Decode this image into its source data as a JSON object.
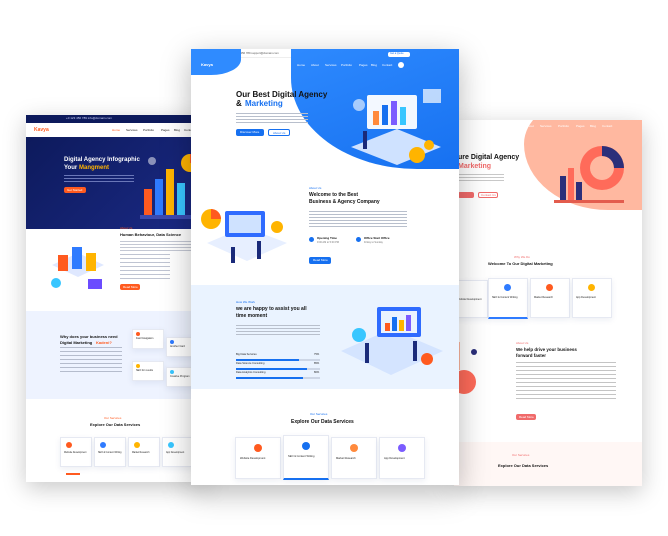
{
  "colors": {
    "blue": "#1670f0",
    "orange": "#ff5a1f",
    "navy": "#0d1a5c",
    "peach": "#ffb8a0",
    "pink": "#f06a6a"
  },
  "left": {
    "contact": "+0 123 456 789  info@domain.com",
    "logo": "Kavya",
    "nav": [
      "Home",
      "Services",
      "Portfolio",
      "Pages",
      "Blog",
      "Contact"
    ],
    "hero_title_1": "Digital Agency Infographic",
    "hero_title_2": "Your",
    "hero_title_hl": "Mangment",
    "hero_btn": "Get Started",
    "about_kicker": "About Us",
    "about_title": "Human Behaviour, Data Science",
    "about_btn": "Read More",
    "why_title_1": "Why does your business need",
    "why_title_2": "Digital Marketing",
    "why_title_hl": "Kadeni?",
    "why_cards": [
      "Fast Navigation",
      "Another Card",
      "SEO for results",
      "Creative Program"
    ],
    "services_kicker": "Our Services",
    "services_title": "Explore Our Data Services",
    "services": [
      "Website Development",
      "SEO & Content Writing",
      "Market Research",
      "App Development"
    ]
  },
  "center": {
    "contact": "+0 123 456 789  support@domain.com",
    "logo": "Kavya",
    "nav": [
      "Home",
      "About",
      "Services",
      "Portfolio",
      "Pages",
      "Blog",
      "Contact"
    ],
    "cta": "Get a Quote",
    "hero_title_1": "Our Best Digital Agency",
    "hero_amp": "&",
    "hero_title_hl": "Marketing",
    "hero_btn_1": "Discover More",
    "hero_btn_2": "About Us",
    "about_kicker": "About Us",
    "about_title_1": "Welcome to the Best",
    "about_title_2": "Business & Agency Company",
    "feature_1": "Opening Time",
    "feature_1_sub": "9:00 AM to 5:00 PM",
    "feature_2": "Office Start Office",
    "feature_2_sub": "Friday to Sunday",
    "about_btn": "Read More",
    "how_kicker": "How We Work",
    "how_title_1": "we are happy to assist you all",
    "how_title_2": "time moment",
    "progress": [
      {
        "label": "Big Data Services",
        "value": 75
      },
      {
        "label": "Data Science Consulting",
        "value": 85
      },
      {
        "label": "Data Analytics Consulting",
        "value": 80
      }
    ],
    "services_kicker": "Our Services",
    "services_title": "Explore Our Data Services",
    "services": [
      "Website Development",
      "SEO & Content Writing",
      "Market Research",
      "App Development"
    ]
  },
  "right": {
    "nav": [
      "Home",
      "About",
      "Services",
      "Portfolio",
      "Pages",
      "Blog",
      "Contact"
    ],
    "hero_title_1": "ure Digital Agency",
    "hero_title_hl": "Marketing",
    "hero_btn": "Contact Us",
    "why_kicker": "Why We Do",
    "why_title": "Welcome To Our Digital Marketing",
    "features": [
      "Website Development",
      "SEO & Content Writing",
      "Market Research",
      "App Development"
    ],
    "about_kicker": "About Us",
    "about_title_1": "We help drive your business",
    "about_title_2": "forward faster",
    "about_btn": "Read More",
    "services_kicker": "Our Services",
    "services_title": "Explore Our Data Services"
  }
}
